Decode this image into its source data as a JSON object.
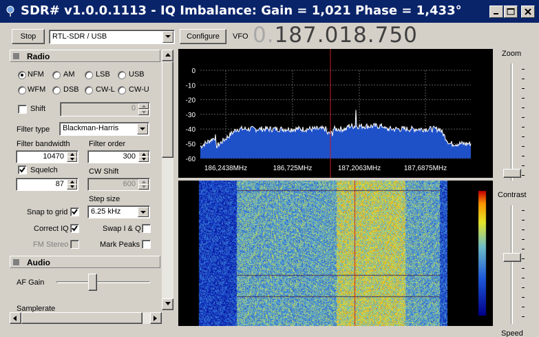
{
  "window": {
    "title": "SDR# v1.0.0.1113 - IQ Imbalance: Gain = 1,021 Phase = 1,433°"
  },
  "toolbar": {
    "stop_label": "Stop",
    "source_value": "RTL-SDR / USB",
    "configure_label": "Configure",
    "vfo_label": "VFO",
    "vfo_dim_digits": "0.",
    "vfo_digits": "187.018.750"
  },
  "radio": {
    "section_title": "Radio",
    "modes": [
      {
        "label": "NFM",
        "selected": true
      },
      {
        "label": "AM",
        "selected": false
      },
      {
        "label": "LSB",
        "selected": false
      },
      {
        "label": "USB",
        "selected": false
      },
      {
        "label": "WFM",
        "selected": false
      },
      {
        "label": "DSB",
        "selected": false
      },
      {
        "label": "CW-L",
        "selected": false
      },
      {
        "label": "CW-U",
        "selected": false
      }
    ],
    "shift_label": "Shift",
    "shift_value": "0",
    "filter_type_label": "Filter type",
    "filter_type_value": "Blackman-Harris",
    "filter_bandwidth_label": "Filter bandwidth",
    "filter_bandwidth_value": "10470",
    "filter_order_label": "Filter order",
    "filter_order_value": "300",
    "squelch_label": "Squelch",
    "squelch_value": "87",
    "cw_shift_label": "CW Shift",
    "cw_shift_value": "600",
    "step_size_label": "Step size",
    "snap_label": "Snap to grid",
    "step_size_value": "6.25 kHz",
    "correct_iq_label": "Correct IQ",
    "swap_iq_label": "Swap I & Q",
    "fm_stereo_label": "FM Stereo",
    "mark_peaks_label": "Mark Peaks"
  },
  "audio": {
    "section_title": "Audio",
    "af_gain_label": "AF Gain",
    "af_gain_level": 0.38,
    "samplerate_label": "Samplerate"
  },
  "spectrum": {
    "db_labels": [
      "0",
      "-10",
      "-20",
      "-30",
      "-40",
      "-50",
      "-60"
    ],
    "freq_labels": [
      "186,2438MHz",
      "186,725MHz",
      "187,2063MHz",
      "187,6875MHz"
    ]
  },
  "right": {
    "zoom_label": "Zoom",
    "contrast_label": "Contrast",
    "speed_label": "Speed"
  },
  "colors": {
    "titlebar": "#0a246a",
    "spectrum_fill": "#1e50c8",
    "center_line": "#c81e1e"
  }
}
